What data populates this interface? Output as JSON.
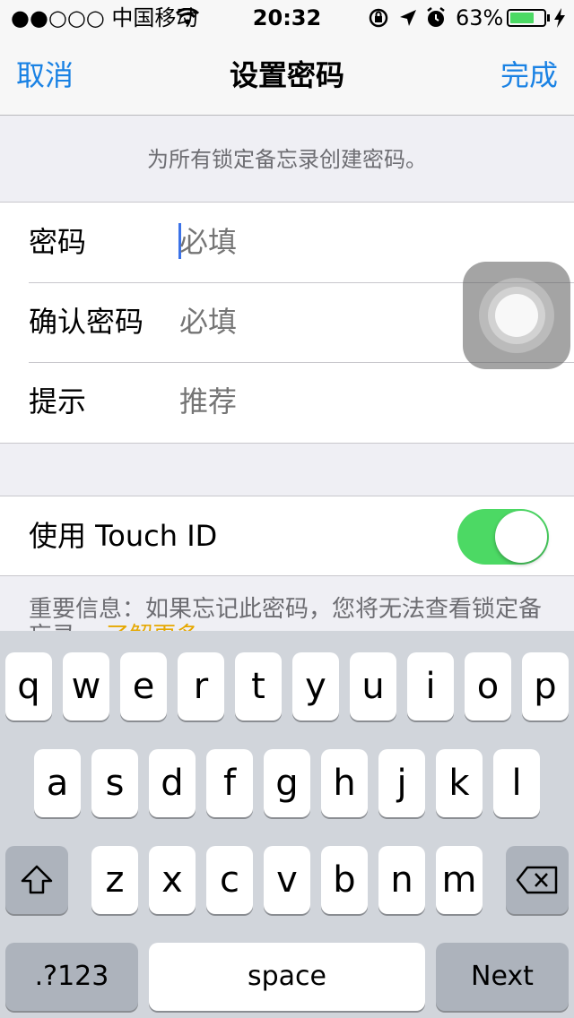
{
  "status_bar": {
    "carrier": "●●○○○ 中国移动",
    "time": "20:32",
    "battery": "63%"
  },
  "nav": {
    "cancel": "取消",
    "title": "设置密码",
    "done": "完成"
  },
  "header_note": "为所有锁定备忘录创建密码。",
  "form": {
    "password_label": "密码",
    "password_placeholder": "必填",
    "confirm_label": "确认密码",
    "confirm_placeholder": "必填",
    "hint_label": "提示",
    "hint_placeholder": "推荐"
  },
  "touch_id": {
    "label": "使用 Touch ID",
    "enabled": true
  },
  "footer": {
    "text": "重要信息：如果忘记此密码，您将无法查看锁定备",
    "peek": "忘录。",
    "learn_more": "了解更多..."
  },
  "keyboard": {
    "row1": [
      "q",
      "w",
      "e",
      "r",
      "t",
      "y",
      "u",
      "i",
      "o",
      "p"
    ],
    "row2": [
      "a",
      "s",
      "d",
      "f",
      "g",
      "h",
      "j",
      "k",
      "l"
    ],
    "row3": [
      "z",
      "x",
      "c",
      "v",
      "b",
      "n",
      "m"
    ],
    "numbers": ".?123",
    "space": "space",
    "next": "Next"
  },
  "colors": {
    "accent": "#1a82e4",
    "toggle_on": "#4cd964",
    "link": "#e6a800"
  },
  "icons": [
    "wifi-icon",
    "lock-rotation-icon",
    "location-icon",
    "alarm-icon",
    "battery-icon",
    "charging-icon",
    "shift-icon",
    "delete-icon",
    "assistive-touch-icon"
  ]
}
